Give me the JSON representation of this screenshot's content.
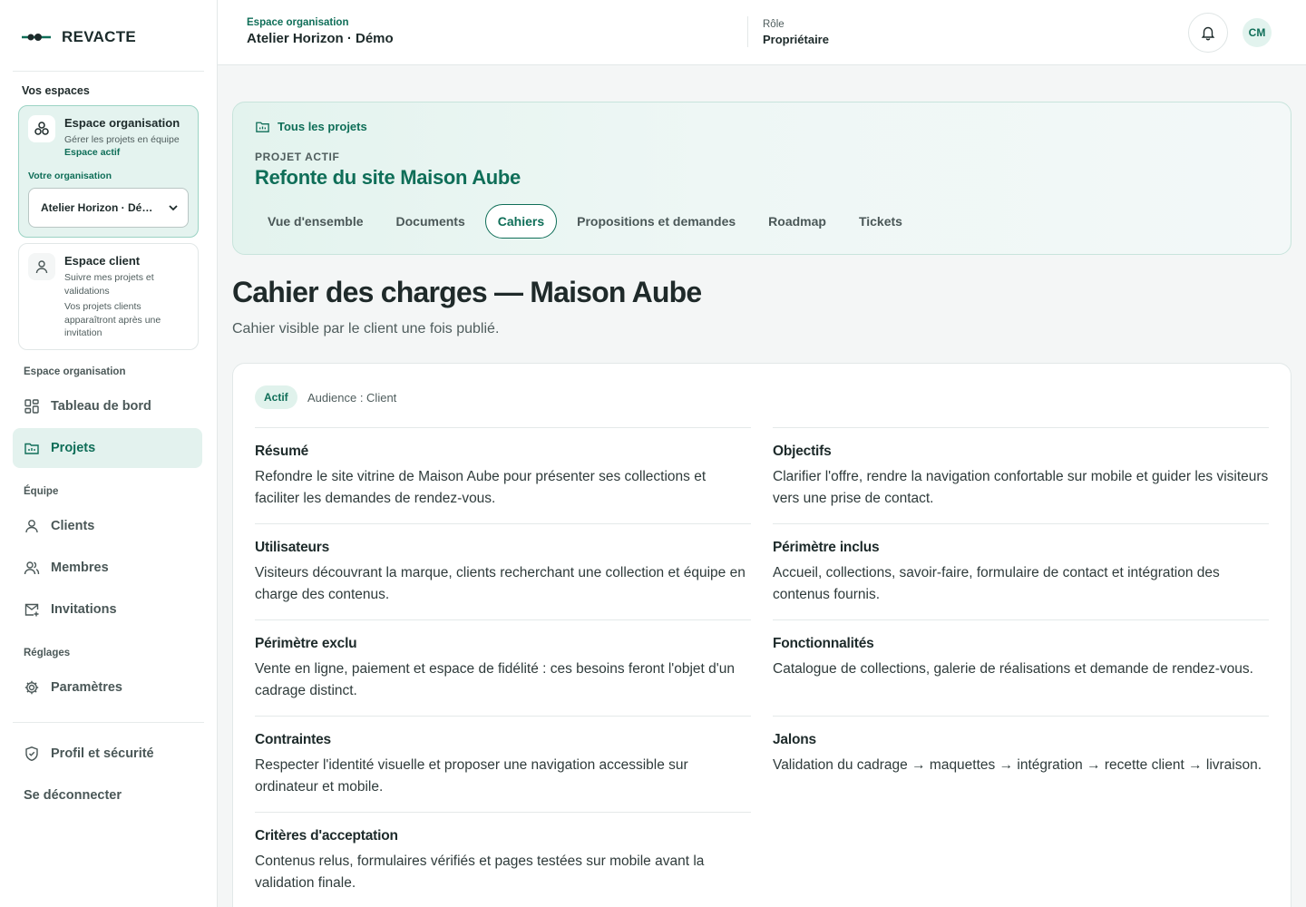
{
  "brand": {
    "name": "REVACTE"
  },
  "sidebar": {
    "spaces_heading": "Vos espaces",
    "org_space": {
      "title": "Espace organisation",
      "description": "Gérer les projets en équipe",
      "status": "Espace actif",
      "org_label": "Votre organisation",
      "org_selected": "Atelier Horizon · Dé…"
    },
    "client_space": {
      "title": "Espace client",
      "description": "Suivre mes projets et validations",
      "note": "Vos projets clients apparaîtront après une invitation"
    },
    "groups": [
      {
        "heading": "Espace organisation",
        "items": [
          "Tableau de bord",
          "Projets"
        ]
      },
      {
        "heading": "Équipe",
        "items": [
          "Clients",
          "Membres",
          "Invitations"
        ]
      },
      {
        "heading": "Réglages",
        "items": [
          "Paramètres"
        ]
      }
    ],
    "footer_items": [
      "Profil et sécurité",
      "Se déconnecter"
    ]
  },
  "header": {
    "kicker": "Espace organisation",
    "title": "Atelier Horizon · Démo",
    "role_label": "Rôle",
    "role_value": "Propriétaire",
    "avatar_initials": "CM"
  },
  "project": {
    "back_link": "Tous les projets",
    "kicker": "PROJET ACTIF",
    "title": "Refonte du site Maison Aube",
    "tabs": [
      "Vue d'ensemble",
      "Documents",
      "Cahiers",
      "Propositions et demandes",
      "Roadmap",
      "Tickets"
    ],
    "active_tab": "Cahiers"
  },
  "page": {
    "title": "Cahier des charges — Maison Aube",
    "subtitle": "Cahier visible par le client une fois publié."
  },
  "document": {
    "status_badge": "Actif",
    "audience": "Audience : Client",
    "sections": [
      {
        "title": "Résumé",
        "body": "Refondre le site vitrine de Maison Aube pour présenter ses collections et faciliter les demandes de rendez-vous."
      },
      {
        "title": "Objectifs",
        "body": "Clarifier l'offre, rendre la navigation confortable sur mobile et guider les visiteurs vers une prise de contact."
      },
      {
        "title": "Utilisateurs",
        "body": "Visiteurs découvrant la marque, clients recherchant une collection et équipe en charge des contenus."
      },
      {
        "title": "Périmètre inclus",
        "body": "Accueil, collections, savoir-faire, formulaire de contact et intégration des contenus fournis."
      },
      {
        "title": "Périmètre exclu",
        "body": "Vente en ligne, paiement et espace de fidélité : ces besoins feront l'objet d'un cadrage distinct."
      },
      {
        "title": "Fonctionnalités",
        "body": "Catalogue de collections, galerie de réalisations et demande de rendez-vous."
      },
      {
        "title": "Contraintes",
        "body": "Respecter l'identité visuelle et proposer une navigation accessible sur ordinateur et mobile."
      },
      {
        "title": "Jalons",
        "body": "Validation du cadrage → maquettes → intégration → recette client → livraison."
      },
      {
        "title": "Critères d'acceptation",
        "body": "Contenus relus, formulaires vérifiés et pages testées sur mobile avant la validation finale."
      }
    ]
  },
  "colors": {
    "accent": "#0f6e58",
    "accent_bg": "#e3f2ee",
    "text": "#1f2a2a",
    "muted": "#4f5d5d"
  }
}
